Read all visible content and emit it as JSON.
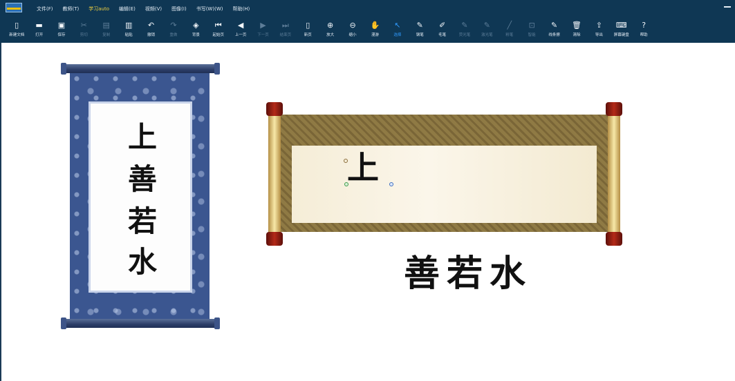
{
  "menu": [
    {
      "label": "文件(F)"
    },
    {
      "label": "教师(T)"
    },
    {
      "label": "学习auto",
      "active": true
    },
    {
      "label": "编辑(E)"
    },
    {
      "label": "视频(V)"
    },
    {
      "label": "图像(I)"
    },
    {
      "label": "书写(W)(W)"
    },
    {
      "label": "帮助(H)"
    }
  ],
  "toolbar": [
    {
      "label": "新建文档",
      "icon": "new-document-icon",
      "glyph": "▯",
      "state": "normal"
    },
    {
      "label": "打开",
      "icon": "folder-open-icon",
      "glyph": "▬",
      "state": "normal"
    },
    {
      "label": "保存",
      "icon": "save-icon",
      "glyph": "▣",
      "state": "normal"
    },
    {
      "label": "剪切",
      "icon": "cut-icon",
      "glyph": "✂",
      "state": "disabled"
    },
    {
      "label": "复制",
      "icon": "copy-icon",
      "glyph": "▤",
      "state": "disabled"
    },
    {
      "label": "粘贴",
      "icon": "paste-icon",
      "glyph": "▥",
      "state": "normal"
    },
    {
      "label": "撤销",
      "icon": "undo-icon",
      "glyph": "↶",
      "state": "normal"
    },
    {
      "label": "重做",
      "icon": "redo-icon",
      "glyph": "↷",
      "state": "disabled"
    },
    {
      "label": "背景",
      "icon": "layers-icon",
      "glyph": "◈",
      "state": "normal"
    },
    {
      "label": "起始页",
      "icon": "first-page-icon",
      "glyph": "⏮",
      "state": "normal"
    },
    {
      "label": "上一页",
      "icon": "previous-page-icon",
      "glyph": "◀",
      "state": "normal"
    },
    {
      "label": "下一页",
      "icon": "next-page-icon",
      "glyph": "▶",
      "state": "disabled"
    },
    {
      "label": "结束页",
      "icon": "last-page-icon",
      "glyph": "⏭",
      "state": "disabled"
    },
    {
      "label": "新页",
      "icon": "new-page-icon",
      "glyph": "▯",
      "state": "normal"
    },
    {
      "label": "放大",
      "icon": "zoom-in-icon",
      "glyph": "⊕",
      "state": "normal"
    },
    {
      "label": "缩小",
      "icon": "zoom-out-icon",
      "glyph": "⊖",
      "state": "normal"
    },
    {
      "label": "漫游",
      "icon": "hand-pan-icon",
      "glyph": "✋",
      "state": "normal"
    },
    {
      "label": "选择",
      "icon": "pointer-icon",
      "glyph": "↖",
      "state": "selected"
    },
    {
      "label": "钢笔",
      "icon": "pen-icon",
      "glyph": "✎",
      "state": "normal"
    },
    {
      "label": "毛笔",
      "icon": "brush-icon",
      "glyph": "✐",
      "state": "normal"
    },
    {
      "label": "荧光笔",
      "icon": "highlighter-icon",
      "glyph": "✎",
      "state": "disabled"
    },
    {
      "label": "激光笔",
      "icon": "laser-pen-icon",
      "glyph": "✎",
      "state": "disabled"
    },
    {
      "label": "粉笔",
      "icon": "chalk-icon",
      "glyph": "╱",
      "state": "disabled"
    },
    {
      "label": "智能",
      "icon": "smart-shape-icon",
      "glyph": "⊡",
      "state": "disabled"
    },
    {
      "label": "线条擦",
      "icon": "eraser-icon",
      "glyph": "✎",
      "state": "normal"
    },
    {
      "label": "清除",
      "icon": "trash-icon",
      "glyph": "🗑",
      "state": "normal"
    },
    {
      "label": "导出",
      "icon": "export-icon",
      "glyph": "⇪",
      "state": "normal"
    },
    {
      "label": "屏幕键盘",
      "icon": "keyboard-icon",
      "glyph": "⌨",
      "state": "normal"
    },
    {
      "label": "帮助",
      "icon": "help-icon",
      "glyph": "?",
      "state": "normal"
    }
  ],
  "vertical_scroll": {
    "chars": [
      "上",
      "善",
      "若",
      "水"
    ]
  },
  "horizontal_scroll": {
    "char": "上"
  },
  "bottom_text": "善若水"
}
